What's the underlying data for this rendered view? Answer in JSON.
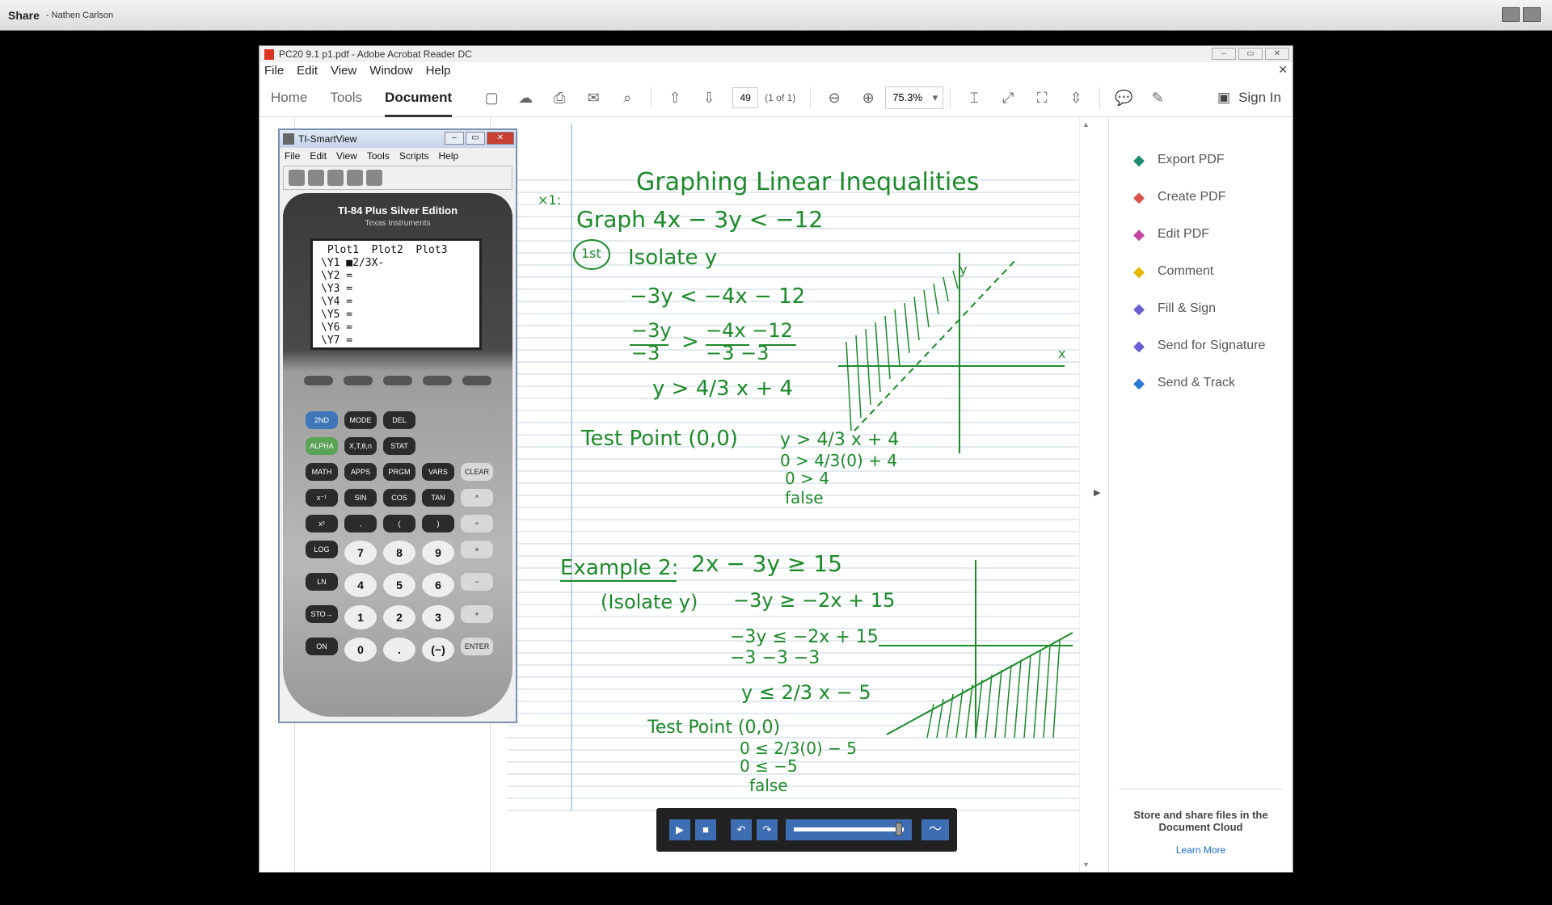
{
  "share_bar": {
    "title": "Share",
    "user": "- Nathen Carlson"
  },
  "acrobat": {
    "title": "PC20 9.1 p1.pdf - Adobe Acrobat Reader DC",
    "menu": [
      "File",
      "Edit",
      "View",
      "Window",
      "Help"
    ],
    "tabs": [
      "Home",
      "Tools",
      "Document"
    ],
    "page_number": "49",
    "page_of": "(1 of 1)",
    "zoom": "75.3%",
    "sign_in": "Sign In",
    "right_tools": [
      {
        "label": "Export PDF",
        "icon": "export-pdf-icon",
        "color": "#1f8a70"
      },
      {
        "label": "Create PDF",
        "icon": "create-pdf-icon",
        "color": "#d9534f"
      },
      {
        "label": "Edit PDF",
        "icon": "edit-pdf-icon",
        "color": "#c445a3"
      },
      {
        "label": "Comment",
        "icon": "comment-icon",
        "color": "#e6b800"
      },
      {
        "label": "Fill & Sign",
        "icon": "fill-sign-icon",
        "color": "#6b5fd3"
      },
      {
        "label": "Send for Signature",
        "icon": "send-signature-icon",
        "color": "#6b5fd3"
      },
      {
        "label": "Send & Track",
        "icon": "send-track-icon",
        "color": "#2a7bd6"
      }
    ],
    "cloud_text": "Store and share files in the Document Cloud",
    "learn_more": "Learn More"
  },
  "ti_smartview": {
    "title": "TI-SmartView",
    "menu": [
      "File",
      "Edit",
      "View",
      "Tools",
      "Scripts",
      "Help"
    ],
    "brand": "TI-84 Plus Silver Edition",
    "maker": "Texas Instruments",
    "screen_lines": [
      " Plot1  Plot2  Plot3",
      "\\Y1 ■2/3X-",
      "\\Y2 =",
      "\\Y3 =",
      "\\Y4 =",
      "\\Y5 =",
      "\\Y6 =",
      "\\Y7 ="
    ],
    "keys": [
      "2ND",
      "MODE",
      "DEL",
      "",
      "",
      "ALPHA",
      "X,T,θ,n",
      "STAT",
      "",
      "",
      "MATH",
      "APPS",
      "PRGM",
      "VARS",
      "CLEAR",
      "x⁻¹",
      "SIN",
      "COS",
      "TAN",
      "^",
      "x²",
      ",",
      "(",
      ")",
      "÷",
      "LOG",
      "7",
      "8",
      "9",
      "×",
      "LN",
      "4",
      "5",
      "6",
      "−",
      "STO→",
      "1",
      "2",
      "3",
      "+",
      "ON",
      "0",
      ".",
      "(−)",
      "ENTER"
    ]
  },
  "notes": {
    "title": "Graphing Linear Inequalities",
    "ex1_label": "×1:",
    "ex1_problem": "Graph 4x − 3y < −12",
    "first_circle": "1st",
    "isolate": "Isolate y",
    "step1": "−3y < −4x − 12",
    "step2_num_left": "−3y",
    "step2_den_left": "−3",
    "step2_rel": ">",
    "step2_num_right": "−4x  −12",
    "step2_den_right": "−3    −3",
    "step3": "y > 4/3 x + 4",
    "test1_label": "Test Point (0,0)",
    "test1_lines": [
      "y > 4/3 x + 4",
      "0 > 4/3(0) + 4",
      "0 > 4",
      "false"
    ],
    "ex2_label": "Example 2:",
    "ex2_problem": "2x − 3y ≥ 15",
    "ex2_isolate": "(Isolate y)",
    "ex2_step1": "−3y ≥ −2x + 15",
    "ex2_step2_num": "−3y  ≤  −2x + 15",
    "ex2_step2_den": "−3       −3     −3",
    "ex2_step3": "y ≤ 2/3 x − 5",
    "test2_label": "Test Point (0,0)",
    "test2_lines": [
      "0 ≤ 2/3(0) − 5",
      "0 ≤ −5",
      "false"
    ],
    "axis_x": "x",
    "axis_y": "y",
    "ink_color": "#1d8a2a"
  },
  "player": {
    "progress": 0.93
  }
}
